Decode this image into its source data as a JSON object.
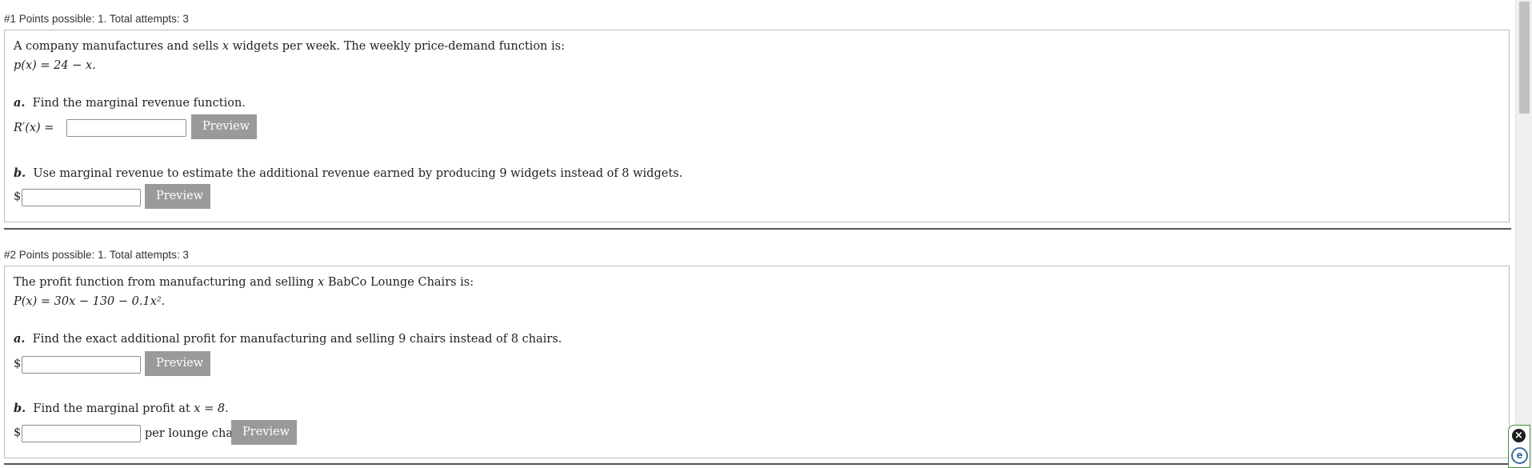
{
  "questions": [
    {
      "header": "#1 Points possible: 1. Total attempts: 3",
      "intro_pre": "A company manufactures and sells ",
      "intro_var": "x",
      "intro_post": " widgets per week. The weekly price-demand function is:",
      "function": "p(x) = 24 − x.",
      "part_a": {
        "letter": "a.",
        "text": "Find the marginal revenue function.",
        "input_label": "R′(x) =",
        "input_value": "",
        "preview_label": "Preview"
      },
      "part_b": {
        "letter": "b.",
        "text": "Use marginal revenue to estimate the additional revenue earned by producing 9 widgets instead of 8 widgets.",
        "prefix": "$",
        "input_value": "",
        "preview_label": "Preview"
      }
    },
    {
      "header": "#2 Points possible: 1. Total attempts: 3",
      "intro_pre": "The profit function from manufacturing and selling ",
      "intro_var": "x",
      "intro_post": " BabCo Lounge Chairs is:",
      "function": "P(x) = 30x − 130 − 0.1x².",
      "part_a": {
        "letter": "a.",
        "text": "Find the exact additional profit for manufacturing and selling 9 chairs instead of 8 chairs.",
        "prefix": "$",
        "input_value": "",
        "preview_label": "Preview"
      },
      "part_b": {
        "letter": "b.",
        "text_pre": "Find the marginal profit at ",
        "text_math": "x = 8",
        "text_post": ".",
        "prefix": "$",
        "input_value": "",
        "suffix": "per lounge chair",
        "preview_label": "Preview"
      }
    }
  ],
  "widget": {
    "close_icon": "×",
    "e_icon": "e"
  }
}
